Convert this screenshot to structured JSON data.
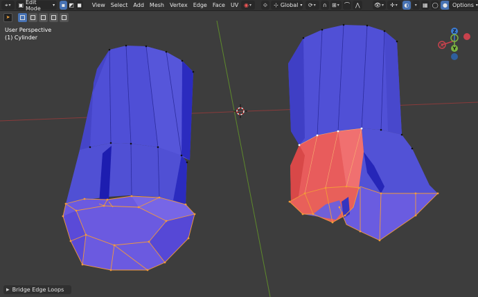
{
  "header": {
    "mode_label": "Edit Mode",
    "menus": [
      "View",
      "Select",
      "Add",
      "Mesh",
      "Vertex",
      "Edge",
      "Face",
      "UV"
    ],
    "transform_orientation": "Global",
    "options_label": "Options"
  },
  "viewport": {
    "perspective_label": "User Perspective",
    "object_label": "(1) Cylinder"
  },
  "gizmo": {
    "z": "Z",
    "y": "Y",
    "x": "X"
  },
  "operator_panel": {
    "label": "Bridge Edge Loops"
  },
  "colors": {
    "background": "#3d3d3d",
    "header": "#303030",
    "accent_blue": "#4772b3",
    "face_blue": "#4f4fd6",
    "selected_face": "#e85a5a",
    "selection_edge": "#f39a3a",
    "x_axis": "#c9424d",
    "y_axis": "#7cb341",
    "z_axis": "#3c7dd8"
  }
}
